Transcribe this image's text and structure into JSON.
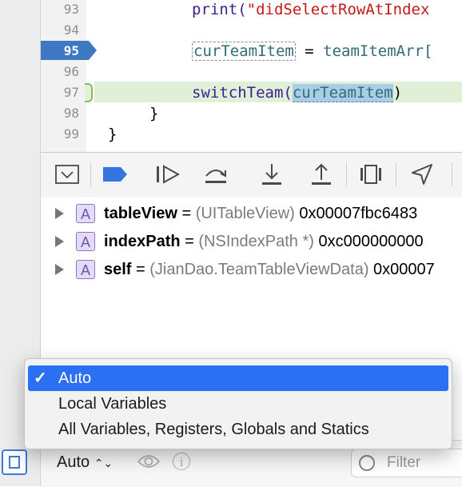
{
  "editor": {
    "lines": [
      {
        "num": "93"
      },
      {
        "num": "94"
      },
      {
        "num": "95"
      },
      {
        "num": "96"
      },
      {
        "num": "97"
      },
      {
        "num": "98"
      },
      {
        "num": "99"
      }
    ],
    "code": {
      "print_fn": "print(",
      "print_str": "\"didSelectRowAtIndex",
      "assign_left": "curTeamItem",
      "assign_op": " = ",
      "assign_right": "teamItemArr[",
      "switch_fn": "switchTeam(",
      "switch_arg": "curTeamItem",
      "switch_close": ")",
      "brace_inner": "}",
      "brace_outer": "}"
    }
  },
  "variables": [
    {
      "icon": "A",
      "name": "tableView",
      "eq": " = ",
      "type": "(UITableView)",
      "value": " 0x00007fbc6483"
    },
    {
      "icon": "A",
      "name": "indexPath",
      "eq": " = ",
      "type": "(NSIndexPath *)",
      "value": " 0xc000000000"
    },
    {
      "icon": "A",
      "name": "self",
      "eq": " = ",
      "type": "(JianDao.TeamTableViewData)",
      "value": " 0x00007"
    }
  ],
  "menu": {
    "items": [
      {
        "label": "Auto",
        "selected": true
      },
      {
        "label": "Local Variables",
        "selected": false
      },
      {
        "label": "All Variables, Registers, Globals and Statics",
        "selected": false
      }
    ],
    "check": "✓"
  },
  "bottom_bar": {
    "scope_value": "Auto",
    "scope_chevron": "⌃⌄",
    "info_glyph": "i",
    "filter_placeholder": "Filter"
  },
  "colors": {
    "accent": "#2b6ff3",
    "breakpoint": "#3e78c3",
    "current_line": "#dff0d7"
  }
}
